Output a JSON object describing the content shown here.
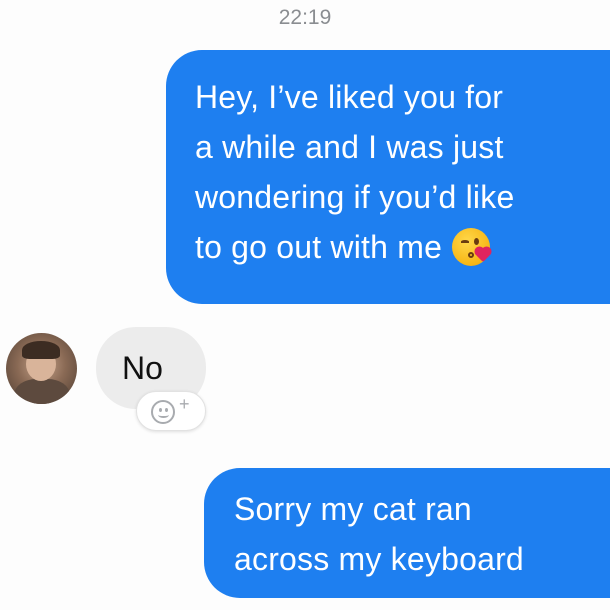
{
  "conversation": {
    "timestamp": "22:19",
    "messages": [
      {
        "from": "me",
        "lines": [
          "Hey, I’ve liked you for",
          "a while and I was just",
          "wondering if you’d like",
          "to go out with me"
        ],
        "emoji": "kissing-heart-emoji"
      },
      {
        "from": "them",
        "text": "No",
        "avatar": "contact-avatar-photo"
      },
      {
        "from": "me",
        "lines": [
          "Sorry my cat ran",
          "across my keyboard"
        ]
      }
    ],
    "reaction_button": {
      "icon": "smiley-icon",
      "plus": "+"
    }
  },
  "colors": {
    "outgoing_bubble": "#1e7ff0",
    "incoming_bubble": "#ececec",
    "timestamp_text": "#8a8d91"
  }
}
